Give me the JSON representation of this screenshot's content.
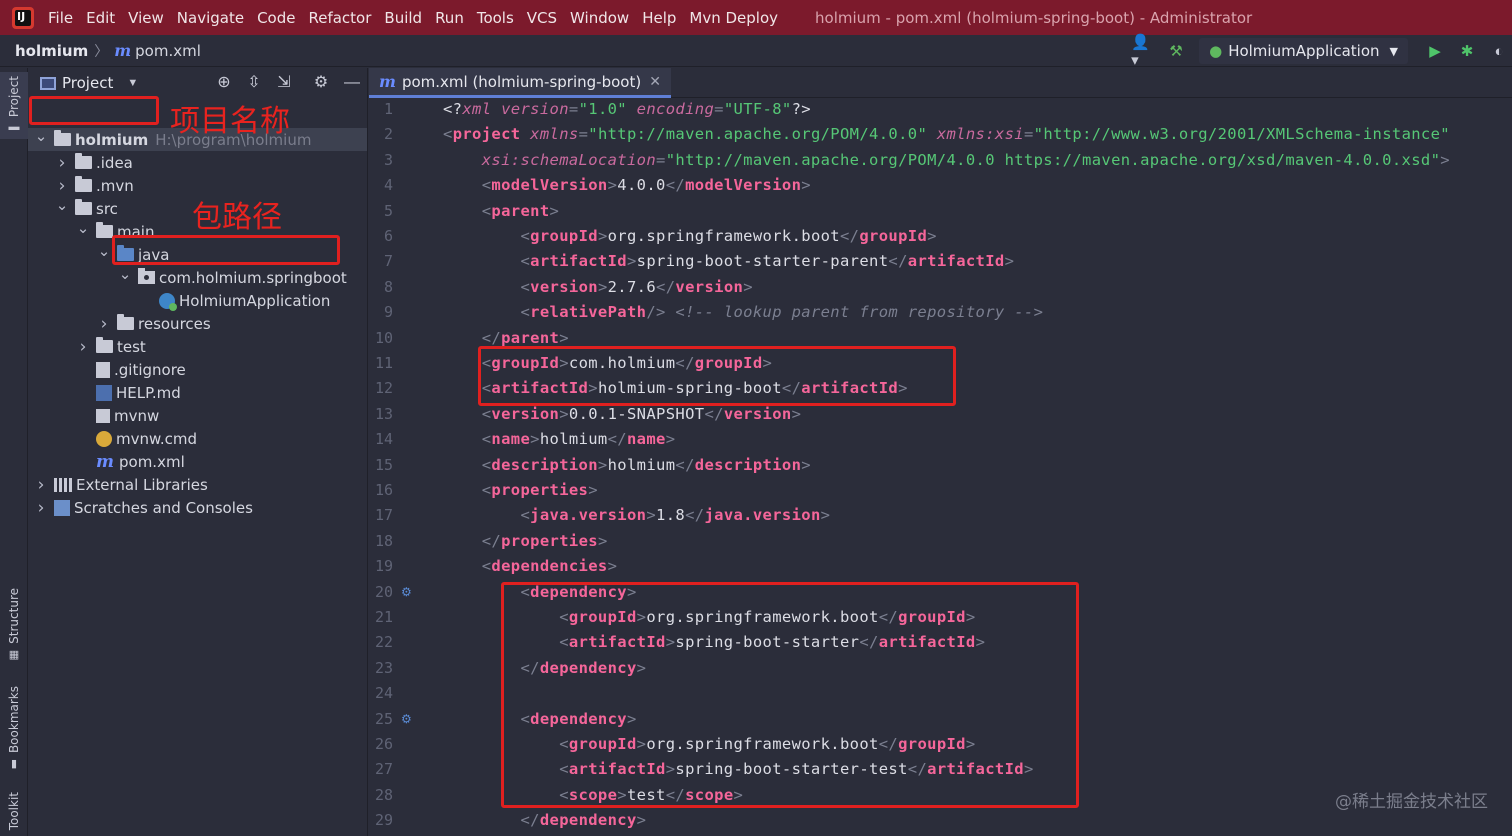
{
  "menubar": {
    "items": [
      "File",
      "Edit",
      "View",
      "Navigate",
      "Code",
      "Refactor",
      "Build",
      "Run",
      "Tools",
      "VCS",
      "Window",
      "Help",
      "Mvn Deploy"
    ],
    "window_title": "holmium - pom.xml (holmium-spring-boot) - Administrator"
  },
  "breadcrumb": {
    "project": "holmium",
    "file": "pom.xml"
  },
  "toolbar": {
    "run_config": "HolmiumApplication"
  },
  "left_strip": {
    "project": "Project",
    "structure": "Structure",
    "bookmarks": "Bookmarks",
    "toolkit": "Toolkit"
  },
  "project_panel": {
    "title": "Project",
    "tree": [
      {
        "label": "holmium",
        "path": "H:\\program\\holmium",
        "depth": 0,
        "icon": "module-folder-icon",
        "expanded": true,
        "bold": true,
        "selected": true
      },
      {
        "label": ".idea",
        "depth": 1,
        "icon": "folder-icon",
        "expanded": false
      },
      {
        "label": ".mvn",
        "depth": 1,
        "icon": "folder-icon",
        "expanded": false
      },
      {
        "label": "src",
        "depth": 1,
        "icon": "folder-icon",
        "expanded": true
      },
      {
        "label": "main",
        "depth": 2,
        "icon": "folder-icon",
        "expanded": true
      },
      {
        "label": "java",
        "depth": 3,
        "icon": "source-folder-icon",
        "expanded": true
      },
      {
        "label": "com.holmium.springboot",
        "depth": 4,
        "icon": "package-icon",
        "expanded": true
      },
      {
        "label": "HolmiumApplication",
        "depth": 5,
        "icon": "spring-class-icon",
        "leaf": true
      },
      {
        "label": "resources",
        "depth": 3,
        "icon": "resources-folder-icon",
        "expanded": false
      },
      {
        "label": "test",
        "depth": 2,
        "icon": "folder-icon",
        "expanded": false
      },
      {
        "label": ".gitignore",
        "depth": 2,
        "icon": "gitignore-icon",
        "leaf": true
      },
      {
        "label": "HELP.md",
        "depth": 2,
        "icon": "markdown-icon",
        "leaf": true
      },
      {
        "label": "mvnw",
        "depth": 2,
        "icon": "terminal-file-icon",
        "leaf": true
      },
      {
        "label": "mvnw.cmd",
        "depth": 2,
        "icon": "cmd-file-icon",
        "leaf": true
      },
      {
        "label": "pom.xml",
        "depth": 2,
        "icon": "maven-icon",
        "leaf": true
      },
      {
        "label": "External Libraries",
        "depth": 0,
        "icon": "library-icon",
        "expanded": false
      },
      {
        "label": "Scratches and Consoles",
        "depth": 0,
        "icon": "scratch-icon",
        "expanded": false
      }
    ]
  },
  "annotations": {
    "project_name": "项目名称",
    "package_path": "包路径"
  },
  "editor": {
    "tab_label": "pom.xml (holmium-spring-boot)",
    "lines": [
      [
        [
          "pi",
          "<?"
        ],
        [
          "a",
          "xml "
        ],
        [
          "a",
          "version"
        ],
        [
          "b",
          "="
        ],
        [
          "s",
          "\"1.0\""
        ],
        [
          "a",
          " encoding"
        ],
        [
          "b",
          "="
        ],
        [
          "s",
          "\"UTF-8\""
        ],
        [
          "pi",
          "?>"
        ]
      ],
      [
        [
          "b",
          "<"
        ],
        [
          "t",
          "project "
        ],
        [
          "a",
          "xmlns"
        ],
        [
          "b",
          "="
        ],
        [
          "s",
          "\"http://maven.apache.org/POM/4.0.0\""
        ],
        [
          "a",
          " xmlns:xsi"
        ],
        [
          "b",
          "="
        ],
        [
          "s",
          "\"http://www.w3.org/2001/XMLSchema-instance\""
        ]
      ],
      [
        [
          "x",
          "    "
        ],
        [
          "a",
          "xsi:schemaLocation"
        ],
        [
          "b",
          "="
        ],
        [
          "s",
          "\"http://maven.apache.org/POM/4.0.0 https://maven.apache.org/xsd/maven-4.0.0.xsd\""
        ],
        [
          "b",
          ">"
        ]
      ],
      [
        [
          "x",
          "    "
        ],
        [
          "b",
          "<"
        ],
        [
          "t",
          "modelVersion"
        ],
        [
          "b",
          ">"
        ],
        [
          "x",
          "4.0.0"
        ],
        [
          "b",
          "</"
        ],
        [
          "t",
          "modelVersion"
        ],
        [
          "b",
          ">"
        ]
      ],
      [
        [
          "x",
          "    "
        ],
        [
          "b",
          "<"
        ],
        [
          "t",
          "parent"
        ],
        [
          "b",
          ">"
        ]
      ],
      [
        [
          "x",
          "        "
        ],
        [
          "b",
          "<"
        ],
        [
          "t",
          "groupId"
        ],
        [
          "b",
          ">"
        ],
        [
          "x",
          "org.springframework.boot"
        ],
        [
          "b",
          "</"
        ],
        [
          "t",
          "groupId"
        ],
        [
          "b",
          ">"
        ]
      ],
      [
        [
          "x",
          "        "
        ],
        [
          "b",
          "<"
        ],
        [
          "t",
          "artifactId"
        ],
        [
          "b",
          ">"
        ],
        [
          "x",
          "spring-boot-starter-parent"
        ],
        [
          "b",
          "</"
        ],
        [
          "t",
          "artifactId"
        ],
        [
          "b",
          ">"
        ]
      ],
      [
        [
          "x",
          "        "
        ],
        [
          "b",
          "<"
        ],
        [
          "t",
          "version"
        ],
        [
          "b",
          ">"
        ],
        [
          "x",
          "2.7.6"
        ],
        [
          "b",
          "</"
        ],
        [
          "t",
          "version"
        ],
        [
          "b",
          ">"
        ]
      ],
      [
        [
          "x",
          "        "
        ],
        [
          "b",
          "<"
        ],
        [
          "t",
          "relativePath"
        ],
        [
          "b",
          "/> "
        ],
        [
          "c",
          "<!-- lookup parent from repository -->"
        ]
      ],
      [
        [
          "x",
          "    "
        ],
        [
          "b",
          "</"
        ],
        [
          "t",
          "parent"
        ],
        [
          "b",
          ">"
        ]
      ],
      [
        [
          "x",
          "    "
        ],
        [
          "b",
          "<"
        ],
        [
          "t",
          "groupId"
        ],
        [
          "b",
          ">"
        ],
        [
          "x",
          "com.holmium"
        ],
        [
          "b",
          "</"
        ],
        [
          "t",
          "groupId"
        ],
        [
          "b",
          ">"
        ]
      ],
      [
        [
          "x",
          "    "
        ],
        [
          "b",
          "<"
        ],
        [
          "t",
          "artifactId"
        ],
        [
          "b",
          ">"
        ],
        [
          "x",
          "holmium-spring-boot"
        ],
        [
          "b",
          "</"
        ],
        [
          "t",
          "artifactId"
        ],
        [
          "b",
          ">"
        ]
      ],
      [
        [
          "x",
          "    "
        ],
        [
          "b",
          "<"
        ],
        [
          "t",
          "version"
        ],
        [
          "b",
          ">"
        ],
        [
          "x",
          "0.0.1-SNAPSHOT"
        ],
        [
          "b",
          "</"
        ],
        [
          "t",
          "version"
        ],
        [
          "b",
          ">"
        ]
      ],
      [
        [
          "x",
          "    "
        ],
        [
          "b",
          "<"
        ],
        [
          "t",
          "name"
        ],
        [
          "b",
          ">"
        ],
        [
          "x",
          "holmium"
        ],
        [
          "b",
          "</"
        ],
        [
          "t",
          "name"
        ],
        [
          "b",
          ">"
        ]
      ],
      [
        [
          "x",
          "    "
        ],
        [
          "b",
          "<"
        ],
        [
          "t",
          "description"
        ],
        [
          "b",
          ">"
        ],
        [
          "x",
          "holmium"
        ],
        [
          "b",
          "</"
        ],
        [
          "t",
          "description"
        ],
        [
          "b",
          ">"
        ]
      ],
      [
        [
          "x",
          "    "
        ],
        [
          "b",
          "<"
        ],
        [
          "t",
          "properties"
        ],
        [
          "b",
          ">"
        ]
      ],
      [
        [
          "x",
          "        "
        ],
        [
          "b",
          "<"
        ],
        [
          "t",
          "java.version"
        ],
        [
          "b",
          ">"
        ],
        [
          "x",
          "1.8"
        ],
        [
          "b",
          "</"
        ],
        [
          "t",
          "java.version"
        ],
        [
          "b",
          ">"
        ]
      ],
      [
        [
          "x",
          "    "
        ],
        [
          "b",
          "</"
        ],
        [
          "t",
          "properties"
        ],
        [
          "b",
          ">"
        ]
      ],
      [
        [
          "x",
          "    "
        ],
        [
          "b",
          "<"
        ],
        [
          "t",
          "dependencies"
        ],
        [
          "b",
          ">"
        ]
      ],
      [
        [
          "x",
          "        "
        ],
        [
          "b",
          "<"
        ],
        [
          "t",
          "dependency"
        ],
        [
          "b",
          ">"
        ]
      ],
      [
        [
          "x",
          "            "
        ],
        [
          "b",
          "<"
        ],
        [
          "t",
          "groupId"
        ],
        [
          "b",
          ">"
        ],
        [
          "x",
          "org.springframework.boot"
        ],
        [
          "b",
          "</"
        ],
        [
          "t",
          "groupId"
        ],
        [
          "b",
          ">"
        ]
      ],
      [
        [
          "x",
          "            "
        ],
        [
          "b",
          "<"
        ],
        [
          "t",
          "artifactId"
        ],
        [
          "b",
          ">"
        ],
        [
          "x",
          "spring-boot-starter"
        ],
        [
          "b",
          "</"
        ],
        [
          "t",
          "artifactId"
        ],
        [
          "b",
          ">"
        ]
      ],
      [
        [
          "x",
          "        "
        ],
        [
          "b",
          "</"
        ],
        [
          "t",
          "dependency"
        ],
        [
          "b",
          ">"
        ]
      ],
      [],
      [
        [
          "x",
          "        "
        ],
        [
          "b",
          "<"
        ],
        [
          "t",
          "dependency"
        ],
        [
          "b",
          ">"
        ]
      ],
      [
        [
          "x",
          "            "
        ],
        [
          "b",
          "<"
        ],
        [
          "t",
          "groupId"
        ],
        [
          "b",
          ">"
        ],
        [
          "x",
          "org.springframework.boot"
        ],
        [
          "b",
          "</"
        ],
        [
          "t",
          "groupId"
        ],
        [
          "b",
          ">"
        ]
      ],
      [
        [
          "x",
          "            "
        ],
        [
          "b",
          "<"
        ],
        [
          "t",
          "artifactId"
        ],
        [
          "b",
          ">"
        ],
        [
          "x",
          "spring-boot-starter-test"
        ],
        [
          "b",
          "</"
        ],
        [
          "t",
          "artifactId"
        ],
        [
          "b",
          ">"
        ]
      ],
      [
        [
          "x",
          "            "
        ],
        [
          "b",
          "<"
        ],
        [
          "t",
          "scope"
        ],
        [
          "b",
          ">"
        ],
        [
          "x",
          "test"
        ],
        [
          "b",
          "</"
        ],
        [
          "t",
          "scope"
        ],
        [
          "b",
          ">"
        ]
      ],
      [
        [
          "x",
          "        "
        ],
        [
          "b",
          "</"
        ],
        [
          "t",
          "dependency"
        ],
        [
          "b",
          ">"
        ]
      ]
    ],
    "gutter_marks": {
      "20": "spring-bean-icon",
      "25": "spring-bean-icon"
    }
  },
  "watermark": "@稀土掘金技术社区"
}
